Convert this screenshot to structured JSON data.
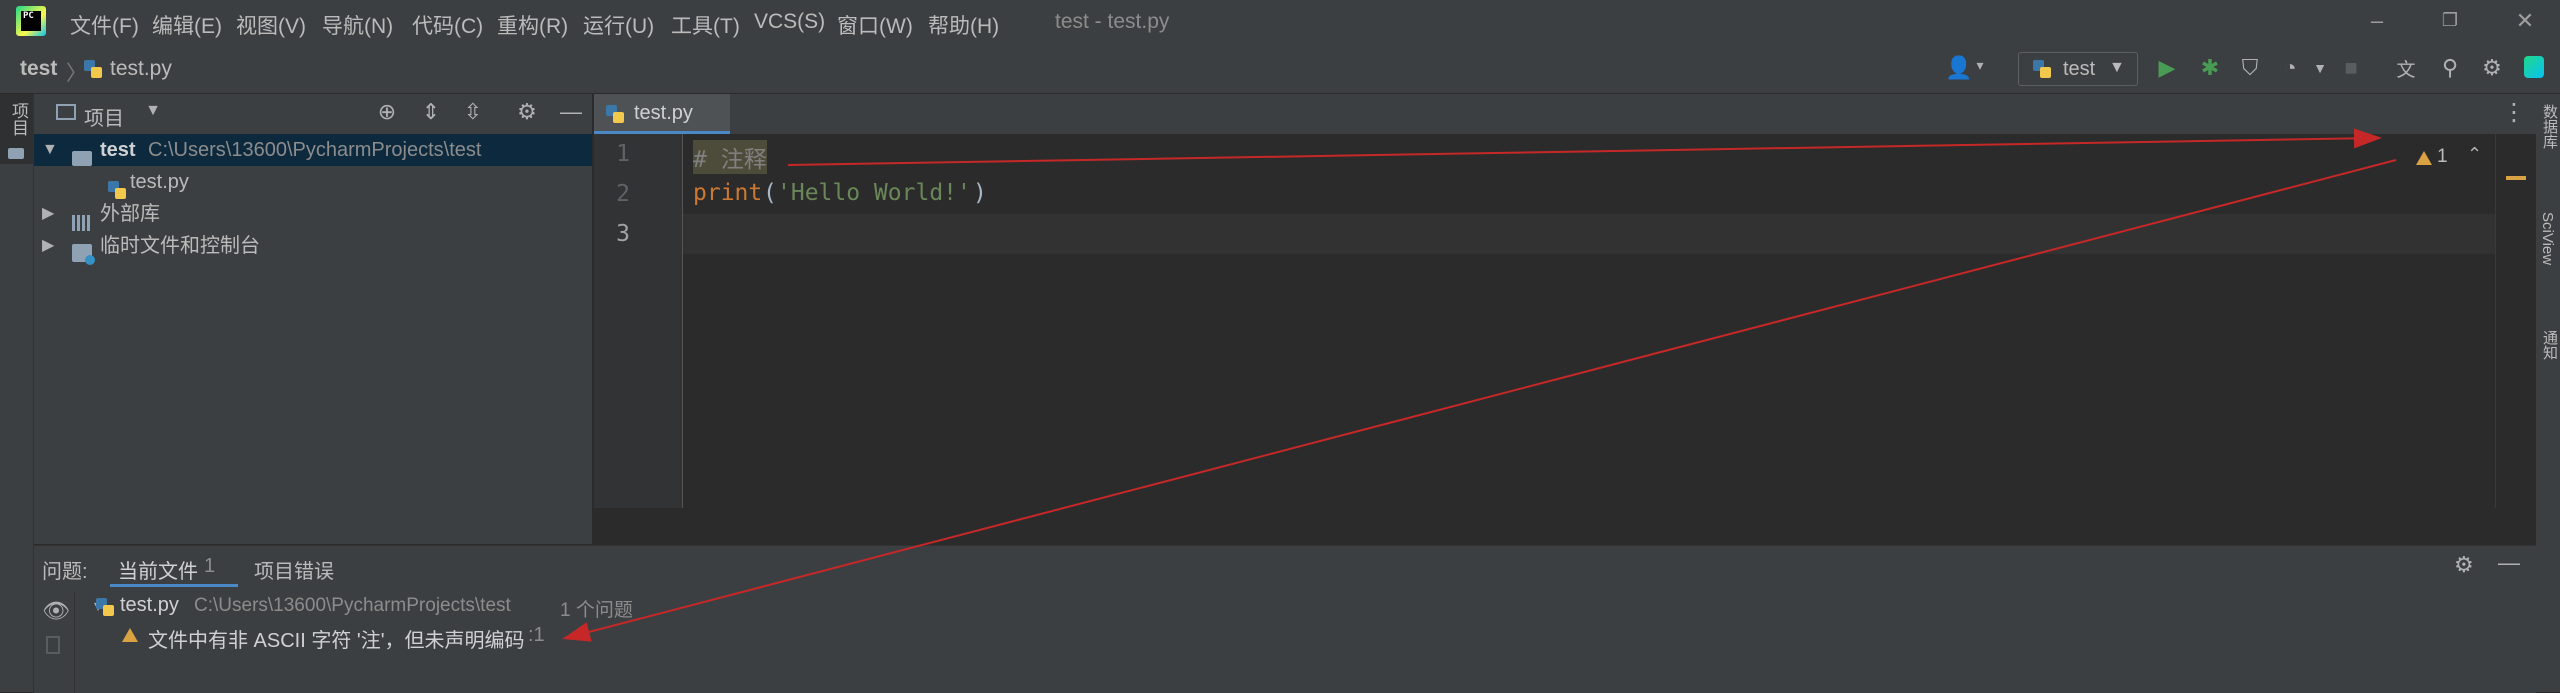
{
  "titlebar": {
    "menus": [
      "文件(F)",
      "编辑(E)",
      "视图(V)",
      "导航(N)",
      "代码(C)",
      "重构(R)",
      "运行(U)",
      "工具(T)",
      "VCS(S)",
      "窗口(W)",
      "帮助(H)"
    ],
    "window_title": "test - test.py",
    "minimize": "–",
    "restore": "❐",
    "close": "✕"
  },
  "navbar": {
    "breadcrumb_project": "test",
    "breadcrumb_file": "test.py",
    "run_config": "test"
  },
  "left_stripe": {
    "project_label": "项目"
  },
  "right_stripe": {
    "database": "数据库",
    "sciview": "SciView",
    "notifications": "通知"
  },
  "project_panel": {
    "title": "项目",
    "tree": {
      "root_name": "test",
      "root_path": "C:\\Users\\13600\\PycharmProjects\\test",
      "file": "test.py",
      "external_libs": "外部库",
      "scratches": "临时文件和控制台"
    }
  },
  "editor": {
    "tab_label": "test.py",
    "line_numbers": [
      "1",
      "2",
      "3"
    ],
    "line1_comment": "# 注释",
    "line2_func": "print",
    "line2_paren_open": "(",
    "line2_string": "'Hello World!'",
    "line2_paren_close": ")",
    "warning_count": "1"
  },
  "problems": {
    "label": "问题:",
    "tab_current": "当前文件",
    "tab_current_count": "1",
    "tab_project": "项目错误",
    "file": "test.py",
    "path": "C:\\Users\\13600\\PycharmProjects\\test",
    "count": "1 个问题",
    "warning_text": "文件中有非 ASCII 字符 '注'，但未声明编码",
    "warning_loc": ":1"
  },
  "colors": {
    "keyword": "#cc7832",
    "string": "#6a8759",
    "comment": "#808080",
    "annotation_arrow": "#c62828",
    "warning": "#d9a343",
    "selection": "#0d293e"
  }
}
